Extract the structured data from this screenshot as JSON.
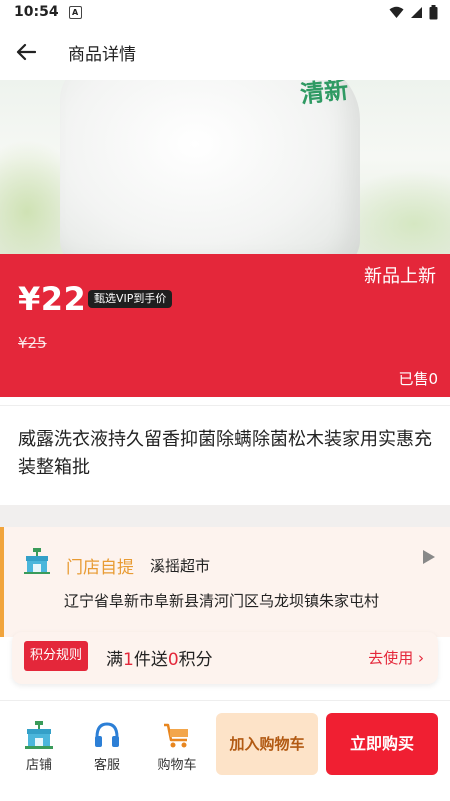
{
  "status_bar": {
    "time": "10:54",
    "notification_icon": "A"
  },
  "header": {
    "title": "商品详情"
  },
  "hero": {
    "overlay_text": "清新"
  },
  "price": {
    "current": "¥22",
    "vip_badge": "甄选VIP到手价",
    "original": "¥25",
    "tag": "新品上新",
    "sold": "已售0"
  },
  "product": {
    "title": "威露洗衣液持久留香抑菌除螨除菌松木装家用实惠充装整箱批"
  },
  "store": {
    "type_label": "门店自提",
    "name": "溪摇超市",
    "address": "辽宁省阜新市阜新县清河门区乌龙坝镇朱家屯村"
  },
  "points": {
    "rule_button": "积分规则",
    "text_prefix": "满",
    "count": "1",
    "text_middle": "件送",
    "points_value": "0",
    "text_suffix": "积分",
    "use_label": "去使用",
    "use_arrow": "›"
  },
  "bottom_nav": {
    "items": [
      {
        "label": "店铺",
        "icon": "store-icon"
      },
      {
        "label": "客服",
        "icon": "headset-icon"
      },
      {
        "label": "购物车",
        "icon": "cart-icon"
      }
    ],
    "add_cart": "加入购物车",
    "buy_now": "立即购买"
  },
  "colors": {
    "accent_red": "#e4273a",
    "buy_red": "#f01f32",
    "store_orange": "#e89b33",
    "cart_bg": "#fde3c8"
  }
}
